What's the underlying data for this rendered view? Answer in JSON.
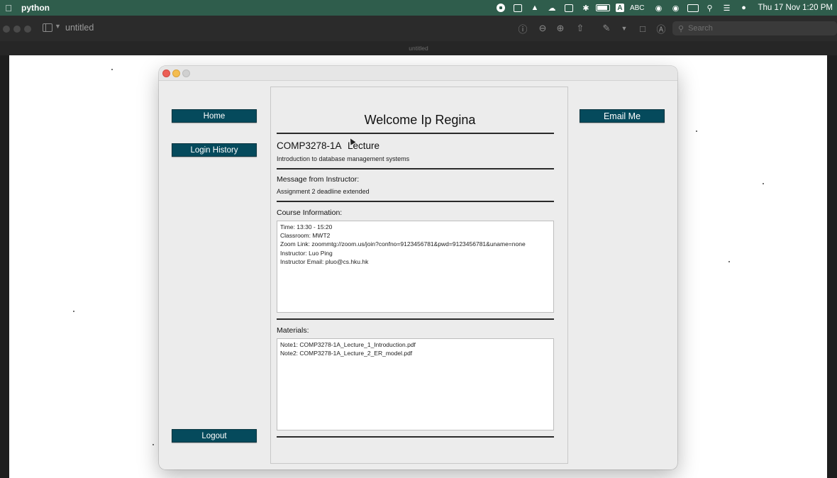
{
  "menubar": {
    "app_name": "python",
    "input_source": "ABC",
    "clock": "Thu 17 Nov  1:20 PM"
  },
  "preview": {
    "title": "untitled",
    "doc_tab": "untitled",
    "search_placeholder": "Search"
  },
  "app": {
    "nav": {
      "home": "Home",
      "login_history": "Login History",
      "logout": "Logout",
      "email_me": "Email Me"
    },
    "welcome": "Welcome Ip Regina",
    "course": {
      "code": "COMP3278-1A",
      "type": "Lecture",
      "description": "Introduction to database management systems"
    },
    "message": {
      "label": "Message from Instructor:",
      "text": "Assignment 2 deadline extended"
    },
    "course_info": {
      "label": "Course Information:",
      "lines": [
        "Time: 13:30 - 15:20",
        "Classroom: MWT2",
        "Zoom Link: zoommtg://zoom.us/join?confno=9123456781&pwd=9123456781&uname=none",
        "Instructor: Luo Ping",
        "Instructor Email: pluo@cs.hku.hk"
      ]
    },
    "materials": {
      "label": "Materials:",
      "lines": [
        "Note1: COMP3278-1A_Lecture_1_Introduction.pdf",
        "Note2: COMP3278-1A_Lecture_2_ER_model.pdf"
      ]
    }
  },
  "colors": {
    "menubar_bg": "#2f5d4c",
    "button_bg": "#054a5c",
    "window_bg": "#ececec"
  },
  "icons": [
    "apple-icon",
    "record-icon",
    "app-store-icon",
    "arc-icon",
    "cloud-icon",
    "screens-icon",
    "bluetooth-icon",
    "battery-icon",
    "input-a-icon",
    "wifi-icon",
    "user-icon",
    "keyboard-icon",
    "search-icon",
    "control-center-icon",
    "siri-icon",
    "info-icon",
    "zoom-out-icon",
    "zoom-in-icon",
    "share-icon",
    "markup-icon",
    "rotate-icon",
    "annotate-icon"
  ]
}
